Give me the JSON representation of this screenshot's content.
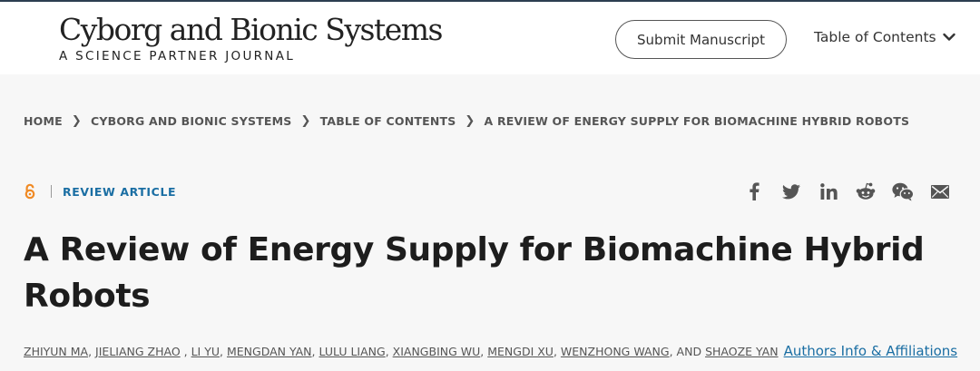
{
  "header": {
    "journal_title": "Cyborg and Bionic Systems",
    "journal_subtitle": "A SCIENCE PARTNER JOURNAL",
    "submit_label": "Submit Manuscript",
    "toc_label": "Table of Contents"
  },
  "breadcrumb": {
    "items": [
      "HOME",
      "CYBORG AND BIONIC SYSTEMS",
      "TABLE OF CONTENTS",
      "A REVIEW OF ENERGY SUPPLY FOR BIOMACHINE HYBRID ROBOTS"
    ]
  },
  "article": {
    "type": "REVIEW ARTICLE",
    "title": "A Review of Energy Supply for Biomachine Hybrid Robots",
    "authors": [
      "ZHIYUN MA",
      "JIELIANG ZHAO",
      "LI YU",
      "MENGDAN YAN",
      "LULU LIANG",
      "XIANGBING WU",
      "MENGDI XU",
      "WENZHONG WANG",
      "SHAOZE YAN"
    ],
    "authors_conjunction": ", AND",
    "affiliations_link": "Authors Info & Affiliations"
  },
  "share": {
    "icons": [
      "facebook-icon",
      "twitter-icon",
      "linkedin-icon",
      "reddit-icon",
      "wechat-icon",
      "email-icon"
    ]
  },
  "colors": {
    "accent": "#1a6ea3",
    "open_access": "#f08a24",
    "title_text": "#1d1d1d"
  }
}
